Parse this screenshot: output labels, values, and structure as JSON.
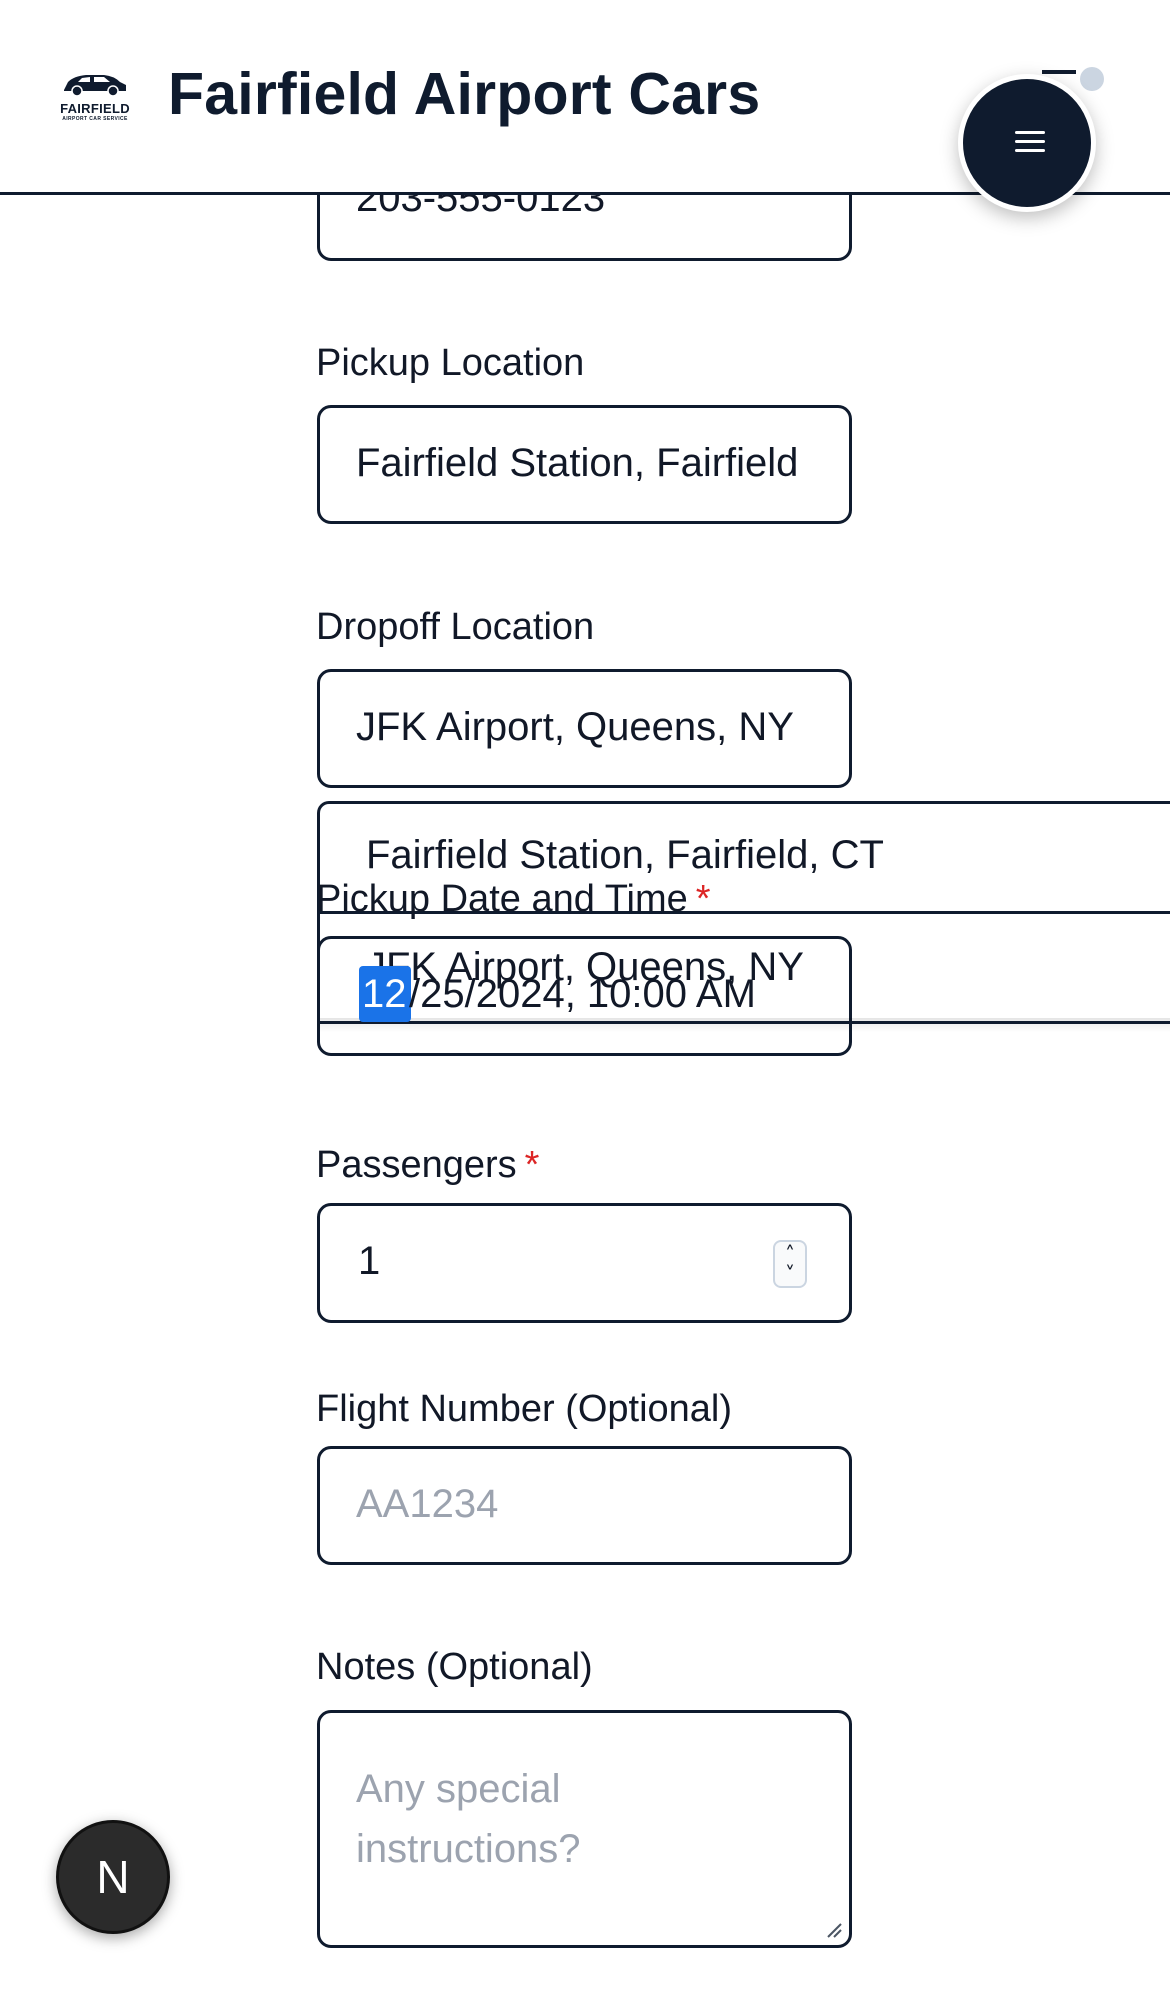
{
  "header": {
    "brand": "Fairfield Airport Cars",
    "logo_text": "FAIRFIELD",
    "logo_sub": "AIRPORT CAR SERVICE",
    "menu_icon": "menu-icon"
  },
  "form": {
    "phone": {
      "value": "203-555-0123"
    },
    "pickup": {
      "label": "Pickup Location",
      "value": "Fairfield Station, Fairfield"
    },
    "dropoff": {
      "label": "Dropoff Location",
      "value": "JFK Airport, Queens, NY"
    },
    "datetime": {
      "label": "Pickup Date and Time",
      "required": "*",
      "selected_segment": "12",
      "rest": "/25/2024, 10:00 AM"
    },
    "passengers": {
      "label": "Passengers",
      "required": "*",
      "value": "1"
    },
    "flight": {
      "label": "Flight Number (Optional)",
      "placeholder": "AA1234"
    },
    "notes": {
      "label": "Notes (Optional)",
      "placeholder": "Any special instructions?"
    }
  },
  "autocomplete": {
    "options": [
      "Fairfield Station, Fairfield, CT",
      "JFK Airport, Queens, NY"
    ]
  },
  "badge": {
    "letter": "N"
  },
  "colors": {
    "navy": "#0f1b2e",
    "required": "#dc2626",
    "selection": "#1a73e8"
  }
}
